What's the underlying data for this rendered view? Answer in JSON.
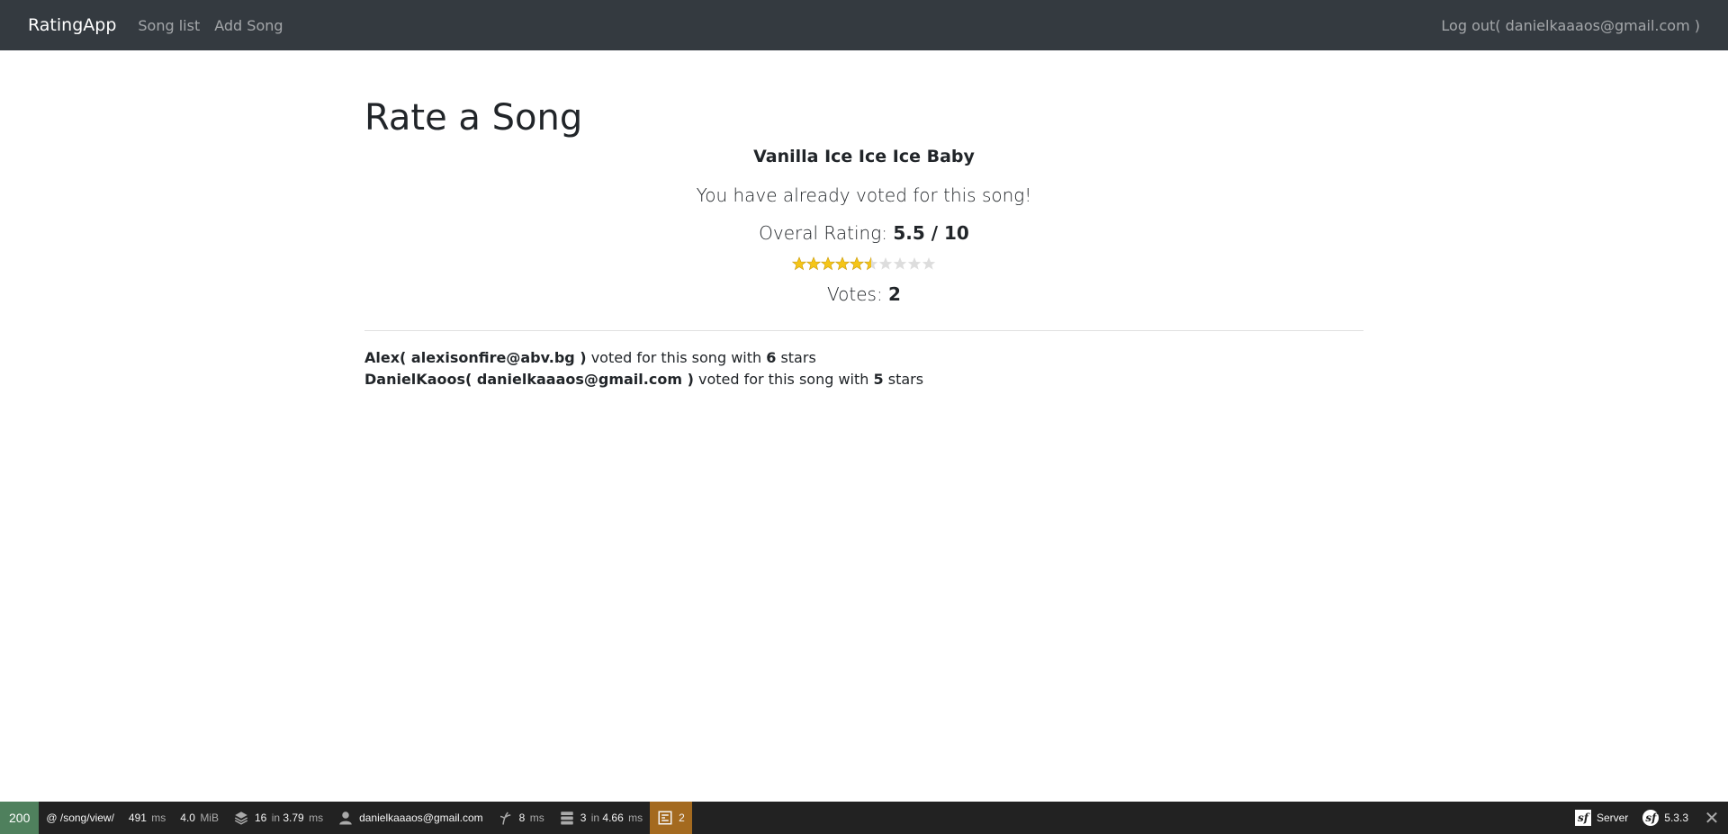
{
  "navbar": {
    "brand": "RatingApp",
    "links": [
      "Song list",
      "Add Song"
    ],
    "logout": "Log out( danielkaaaos@gmail.com )"
  },
  "page": {
    "title": "Rate a Song",
    "song_title": "Vanilla Ice Ice Ice Baby",
    "voted_message": "You have already voted for this song!",
    "rating_label": "Overal Rating: ",
    "rating_value": "5.5 / 10",
    "rating_numeric": 5.5,
    "rating_max": 10,
    "votes_label": "Votes: ",
    "votes_value": "2",
    "star_color_filled": "#f5c518",
    "star_color_empty": "#dddddd"
  },
  "votes": [
    {
      "user": "Alex( alexisonfire@abv.bg )",
      "text": " voted for this song with ",
      "stars": "6",
      "suffix": " stars"
    },
    {
      "user": "DanielKaoos( danielkaaaos@gmail.com )",
      "text": " voted for this song with ",
      "stars": "5",
      "suffix": " stars"
    }
  ],
  "toolbar": {
    "status": "200",
    "route": "@ /song/view/",
    "time": "491",
    "time_unit": "ms",
    "memory": "4.0",
    "memory_unit": "MiB",
    "cache_count": "16",
    "cache_in": "in",
    "cache_time": "3.79",
    "cache_unit": "ms",
    "user": "danielkaaaos@gmail.com",
    "twig_time": "8",
    "twig_unit": "ms",
    "db_count": "3",
    "db_in": "in",
    "db_time": "4.66",
    "db_unit": "ms",
    "warnings": "2",
    "server": "Server",
    "version": "5.3.3",
    "icons": [
      "layers-icon",
      "user-icon",
      "twig-icon",
      "database-icon",
      "form-icon",
      "symfony-icon",
      "close-icon"
    ]
  }
}
